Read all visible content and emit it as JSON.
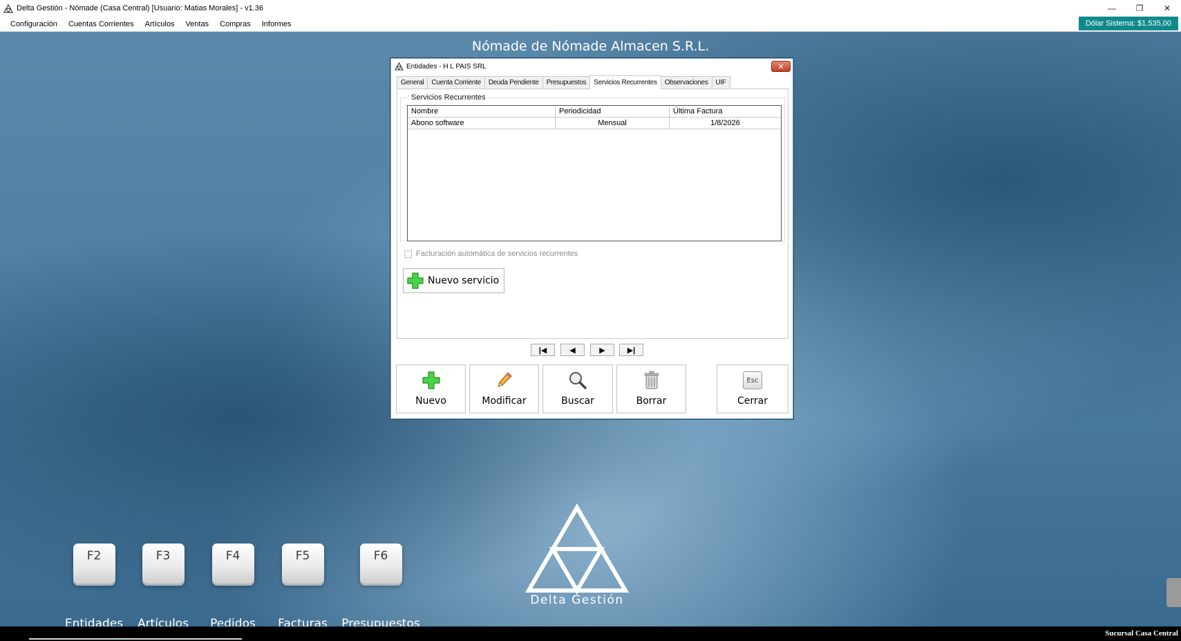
{
  "window": {
    "title": "Delta Gestión - Nómade (Casa Central) [Usuario: Matias  Morales] - v1.36",
    "minimize": "—",
    "restore": "❐",
    "close": "✕"
  },
  "menu": {
    "items": [
      "Configuración",
      "Cuentas Corrientes",
      "Artículos",
      "Ventas",
      "Compras",
      "Informes"
    ]
  },
  "dolar": "Dólar Sistema: $1.535,00",
  "company": "Nómade de Nómade Almacen S.R.L.",
  "dialog": {
    "title": "Entidades - H L PAIS SRL",
    "close": "✕",
    "tabs": [
      "General",
      "Cuenta Corriente",
      "Deuda Pendiente",
      "Presupuestos",
      "Servicios Recurrentes",
      "Observaciones",
      "UIF"
    ],
    "active_tab": "Servicios Recurrentes",
    "group_title": "Servicios Recurrentes",
    "grid": {
      "columns": [
        "Nombre",
        "Periodicidad",
        "Última Factura"
      ],
      "rows": [
        {
          "nombre": "Abono software",
          "periodicidad": "Mensual",
          "ultima": "1/8/2026"
        }
      ]
    },
    "auto_billing_label": "Facturación automática de servicios recurrentes",
    "new_service": "Nuevo servicio",
    "nav": {
      "first": "|◀",
      "prev": "◀",
      "next": "▶",
      "last": "▶|"
    },
    "buttons": {
      "nuevo": "Nuevo",
      "modificar": "Modificar",
      "buscar": "Buscar",
      "borrar": "Borrar",
      "cerrar": "Cerrar",
      "esc": "Esc"
    }
  },
  "fkeys": [
    {
      "key": "F2",
      "label": "Entidades"
    },
    {
      "key": "F3",
      "label": "Artículos"
    },
    {
      "key": "F4",
      "label": "Pedidos"
    },
    {
      "key": "F5",
      "label": "Facturas"
    },
    {
      "key": "F6",
      "label": "Presupuestos"
    }
  ],
  "logo_text": "Delta Gestión",
  "status": "Sucursal Casa Central",
  "colors": {
    "accent": "#0f8a8c",
    "close_red": "#c4402a",
    "green_plus": "#3cc43c"
  }
}
